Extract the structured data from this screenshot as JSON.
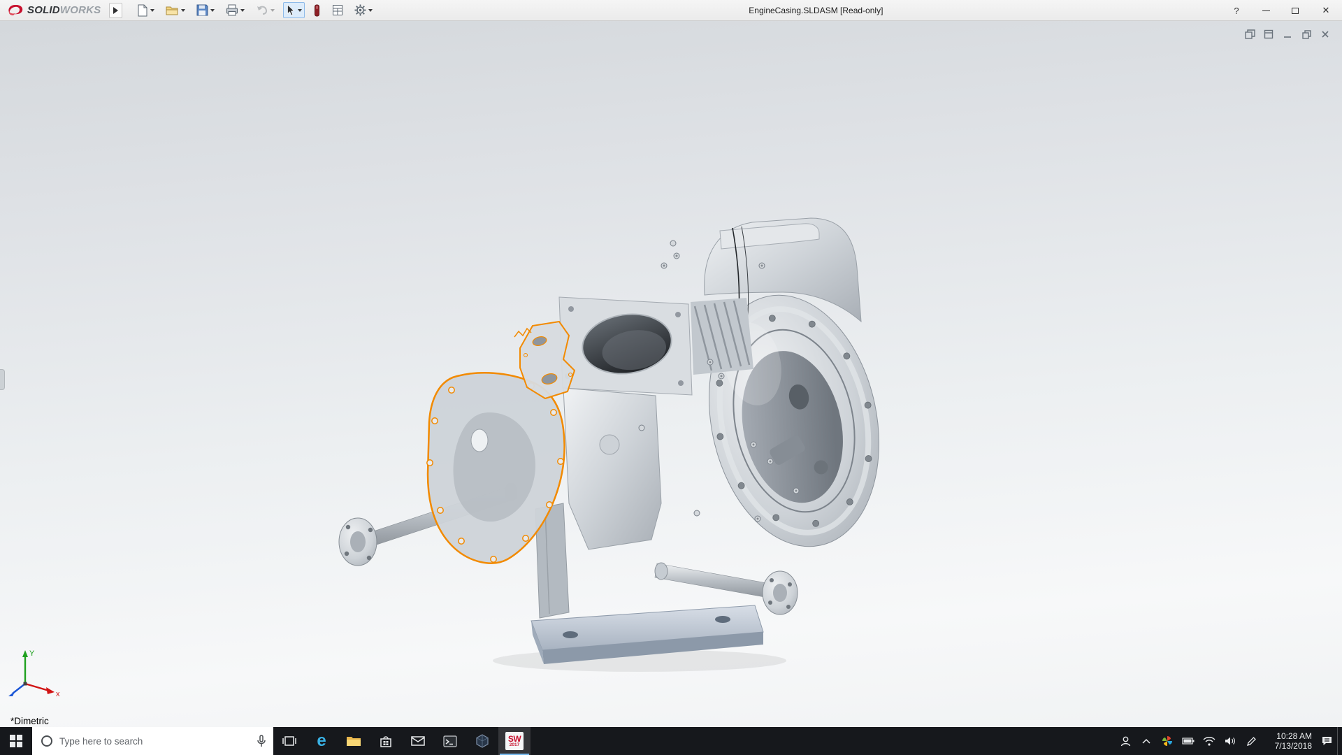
{
  "window": {
    "brand": {
      "solid": "SOLID",
      "works": "WORKS"
    },
    "title": "EngineCasing.SLDASM [Read-only]",
    "help_glyph": "?",
    "close_glyph": "✕"
  },
  "toolbar": {
    "items": [
      {
        "name": "new-document",
        "dropdown": true
      },
      {
        "name": "open",
        "dropdown": true
      },
      {
        "name": "save",
        "dropdown": true
      },
      {
        "name": "print",
        "dropdown": true
      },
      {
        "name": "undo",
        "dropdown": true,
        "disabled": true
      },
      {
        "name": "select",
        "dropdown": true,
        "active": true
      },
      {
        "name": "xpress-products",
        "dropdown": false
      },
      {
        "name": "file-properties",
        "dropdown": false
      },
      {
        "name": "options",
        "dropdown": true
      }
    ]
  },
  "viewport": {
    "view_orientation_label": "*Dimetric",
    "triad": {
      "x_label": "x",
      "y_label": "Y"
    },
    "selection_color": "#f28a00"
  },
  "taskbar": {
    "search_placeholder": "Type here to search",
    "edge_glyph": "e",
    "solidworks_badge": {
      "line1": "SW",
      "line2": "2017"
    },
    "clock": {
      "time": "10:28 AM",
      "date": "7/13/2018"
    }
  }
}
